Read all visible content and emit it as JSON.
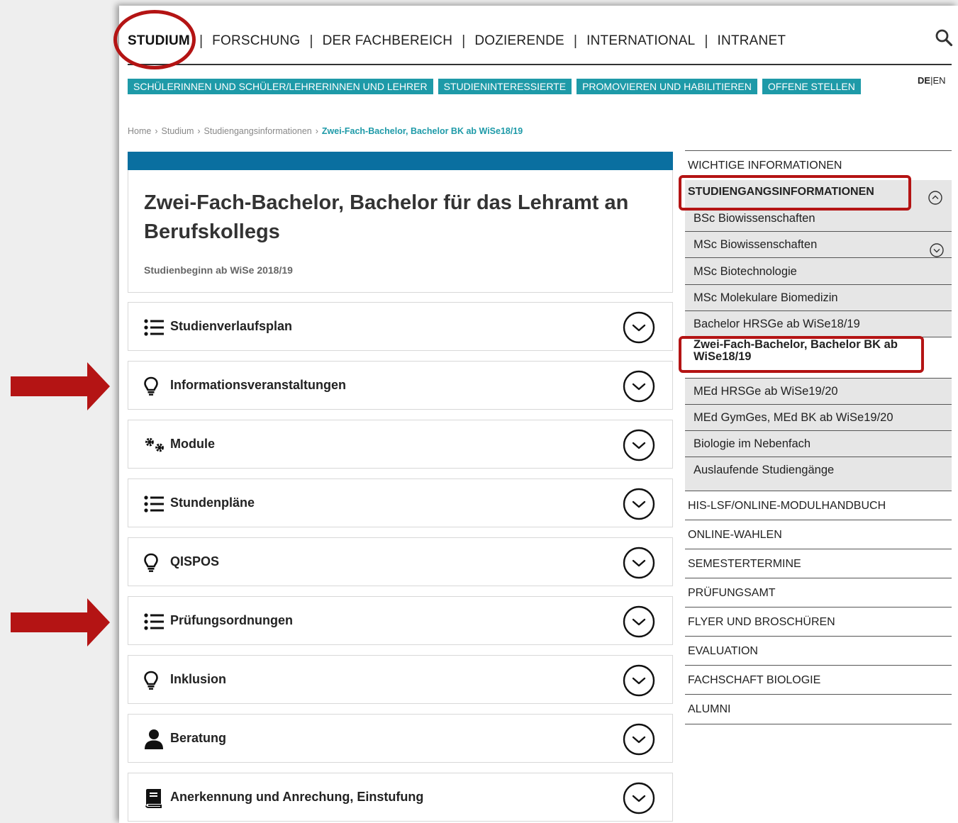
{
  "topnav": {
    "items": [
      "STUDIUM",
      "FORSCHUNG",
      "DER FACHBEREICH",
      "DOZIERENDE",
      "INTERNATIONAL",
      "INTRANET"
    ],
    "active": "STUDIUM",
    "separator": "|"
  },
  "subnav": [
    "SCHÜLERINNEN UND SCHÜLER/LEHRERINNEN UND LEHRER",
    "STUDIENINTERESSIERTE",
    "PROMOVIEREN UND HABILITIEREN",
    "OFFENE STELLEN"
  ],
  "lang": {
    "de": "DE",
    "sep": "|",
    "en": "EN"
  },
  "breadcrumb": {
    "items": [
      "Home",
      "Studium",
      "Studiengangsinformationen"
    ],
    "current": "Zwei-Fach-Bachelor, Bachelor BK ab WiSe18/19",
    "separator": "›"
  },
  "hero": {
    "title": "Zwei-Fach-Bachelor, Bachelor für das Lehramt an Berufskollegs",
    "subtitle": "Studienbeginn ab WiSe 2018/19"
  },
  "accordion": [
    {
      "label": "Studienverlaufsplan",
      "icon": "list-icon"
    },
    {
      "label": "Informationsveranstaltungen",
      "icon": "lightbulb-icon"
    },
    {
      "label": "Module",
      "icon": "gears-icon"
    },
    {
      "label": "Stundenpläne",
      "icon": "list-icon"
    },
    {
      "label": "QISPOS",
      "icon": "lightbulb-icon"
    },
    {
      "label": "Prüfungsordnungen",
      "icon": "list-icon"
    },
    {
      "label": "Inklusion",
      "icon": "lightbulb-icon"
    },
    {
      "label": "Beratung",
      "icon": "user-icon"
    },
    {
      "label": "Anerkennung und Anrechung, Einstufung",
      "icon": "book-icon"
    }
  ],
  "sidebar": {
    "top": "WICHTIGE INFORMATIONEN",
    "group_title": "STUDIENGANGSINFORMATIONEN",
    "sub_items": [
      "BSc Biowissenschaften",
      "MSc Biowissenschaften",
      "MSc Biotechnologie",
      "MSc Molekulare Biomedizin",
      "Bachelor HRSGe ab WiSe18/19",
      "Zwei-Fach-Bachelor, Bachelor BK ab WiSe18/19",
      "MEd HRSGe ab WiSe19/20",
      "MEd GymGes, MEd BK ab WiSe19/20",
      "Biologie im Nebenfach",
      "Auslaufende Studiengänge"
    ],
    "current_sub": "Zwei-Fach-Bachelor, Bachelor BK ab WiSe18/19",
    "bottom": [
      "HIS-LSF/ONLINE-MODULHANDBUCH",
      "ONLINE-WAHLEN",
      "SEMESTERTERMINE",
      "PRÜFUNGSAMT",
      "FLYER UND BROSCHÜREN",
      "EVALUATION",
      "FACHSCHAFT BIOLOGIE",
      "ALUMNI"
    ]
  },
  "colors": {
    "teal": "#1e9aa8",
    "blue_bar": "#0a6fa0",
    "annotation_red": "#b41414"
  },
  "icons": {
    "search": "search-icon"
  }
}
